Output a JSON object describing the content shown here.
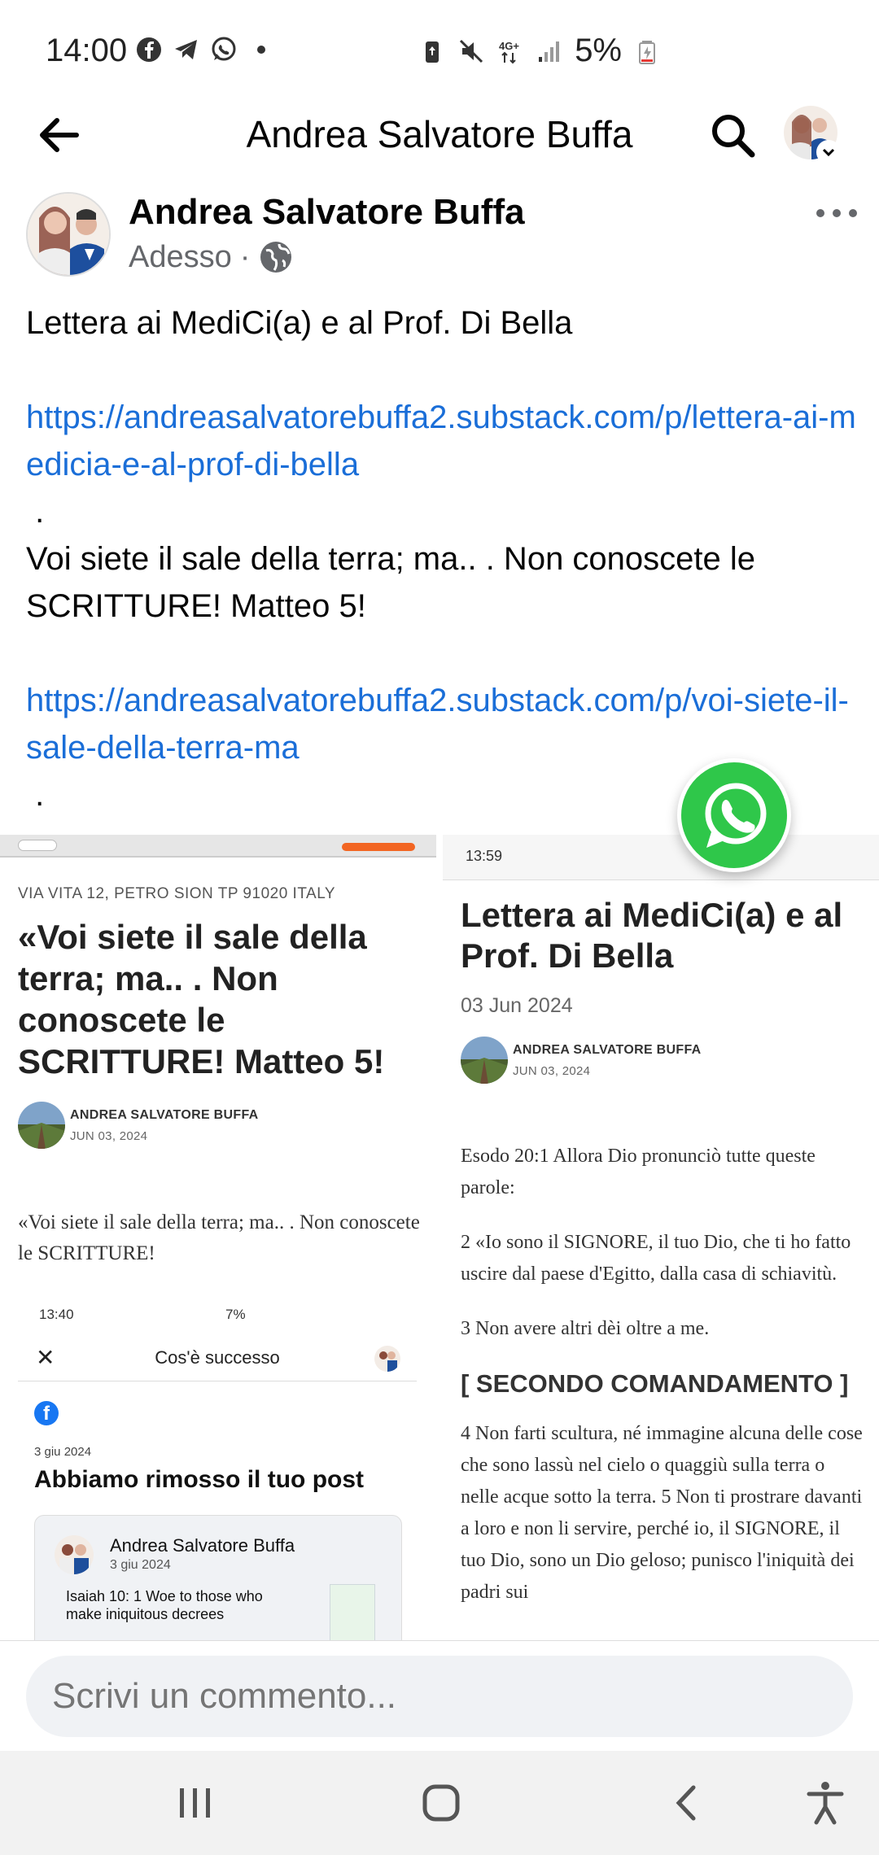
{
  "status_bar": {
    "time": "14:00",
    "left_icons": [
      "facebook-icon",
      "telegram-icon",
      "whatsapp-icon",
      "dot-icon"
    ],
    "right_icons": [
      "battery-saver-icon",
      "mute-icon",
      "4g-signal-icon",
      "signal-bars-icon"
    ],
    "battery": "5%"
  },
  "app_bar": {
    "title": "Andrea Salvatore Buffa"
  },
  "post": {
    "author": "Andrea Salvatore Buffa",
    "time": "Adesso",
    "separator": "·",
    "privacy_icon": "globe-icon",
    "lines": {
      "line1": "Lettera ai MediCi(a) e al Prof. Di Bella",
      "link1": "https://andreasalvatorebuffa2.substack.com/p/lettera-ai-medicia-e-al-prof-di-bella",
      "dot1": " .",
      "line2": "Voi siete il sale della terra; ma.. . Non conoscete le SCRITTURE! Matteo 5!",
      "link2": "https://andreasalvatorebuffa2.substack.com/p/voi-siete-il-sale-della-terra-ma",
      "dot2": " ."
    }
  },
  "left_image": {
    "address": "VIA VITA 12, PETRO SION TP 91020 ITALY",
    "headline": "«Voi siete il sale della terra; ma.. . Non conoscete le SCRITTURE! Matteo 5!",
    "byline_name": "ANDREA SALVATORE BUFFA",
    "byline_date": "JUN 03, 2024",
    "quote": "«Voi siete il sale della terra; ma.. . Non conoscete le SCRITTURE!",
    "inner": {
      "status_time": "13:40",
      "status_right": "7%",
      "title": "Cos'è successo",
      "date": "3 giu 2024",
      "heading": "Abbiamo rimosso il tuo post",
      "card_name": "Andrea Salvatore Buffa",
      "card_date": "3 giu 2024",
      "card_text": "Isaiah 10: 1 Woe to those who make iniquitous decrees"
    }
  },
  "right_image": {
    "status_time": "13:59",
    "title": "Lettera ai MediCi(a) e al Prof. Di Bella",
    "date": "03 Jun 2024",
    "byline_name": "ANDREA SALVATORE BUFFA",
    "byline_date": "JUN 03, 2024",
    "p1": "Esodo 20:1 Allora Dio pronunciò tutte queste parole:",
    "p2": "2 «Io sono il SIGNORE, il tuo Dio, che ti ho fatto uscire dal paese d'Egitto, dalla casa di schiavitù.",
    "p3": "3 Non avere altri dèi oltre a me.",
    "section": "[ SECONDO COMANDAMENTO ]",
    "p4": "4 Non farti scultura, né immagine alcuna delle cose che sono lassù nel cielo o quaggiù sulla terra o nelle acque sotto la terra. 5 Non ti prostrare davanti a loro e non li servire, perché io, il SIGNORE, il tuo Dio, sono un Dio geloso; punisco l'iniquità dei padri sui"
  },
  "comment": {
    "placeholder": "Scrivi un commento..."
  },
  "nav": {
    "buttons": [
      "recent-apps-icon",
      "home-icon",
      "back-icon",
      "accessibility-icon"
    ]
  },
  "colors": {
    "link": "#1a6ed8",
    "whatsapp": "#2fc74a",
    "facebook": "#1877f2",
    "muted": "#65676b"
  }
}
